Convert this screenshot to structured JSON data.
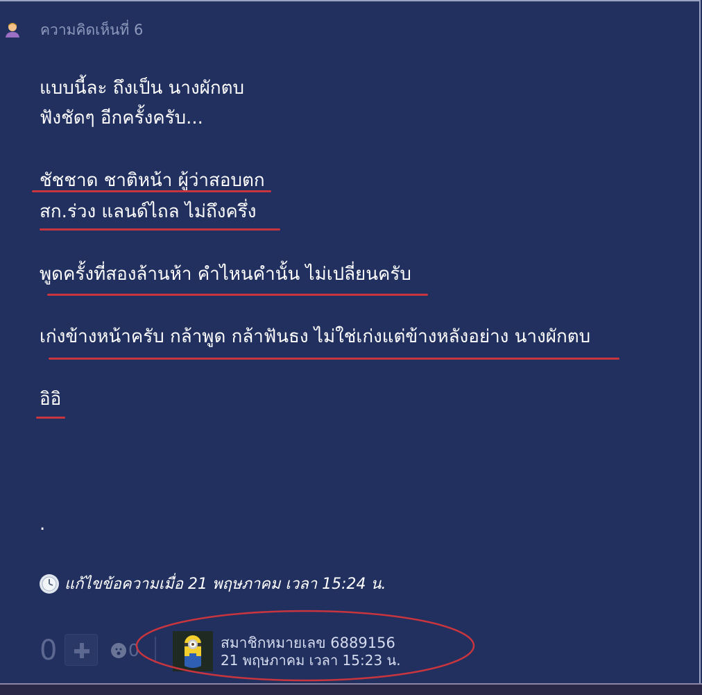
{
  "comment": {
    "label": "ความคิดเห็นที่ 6",
    "lines": [
      "แบบนี้ละ  ถึงเป็น นางผักตบ",
      "ฟังชัดๆ  อีกครั้งครับ...",
      "ชัชชาด ชาติหน้า ผู้ว่าสอบตก",
      "สก.ร่วง  แลนด์ไถล ไม่ถึงครึ่ง",
      "พูดครั้งที่สองล้านห้า  คำไหนคำนั้น ไม่เปลี่ยนครับ",
      "เก่งข้างหน้าครับ กล้าพูด กล้าฟันธง ไม่ใช่เก่งแต่ข้างหลังอย่าง นางผักตบ",
      "อิอิ",
      "."
    ],
    "edited_text": "แก้ไขข้อความเมื่อ 21 พฤษภาคม เวลา 15:24 น."
  },
  "footer": {
    "vote_count": "0",
    "emoji_count": "0",
    "member_name": "สมาชิกหมายเลข 6889156",
    "post_time": "21 พฤษภาคม เวลา 15:23 น."
  },
  "colors": {
    "background": "#22305f",
    "underline": "#c8353f",
    "text": "#ffffff",
    "muted": "#8f99bd"
  }
}
